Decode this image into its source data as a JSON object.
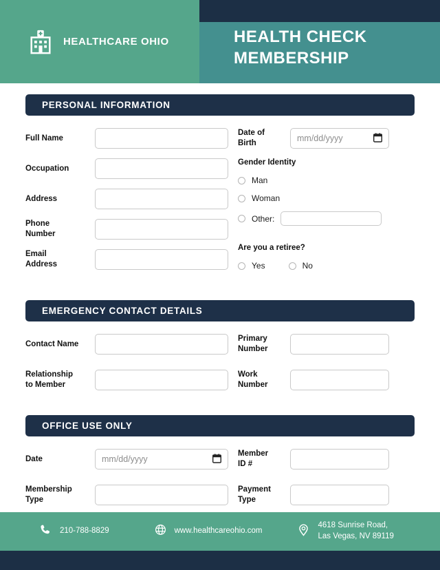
{
  "header": {
    "logo_icon": "hospital-icon",
    "brand": "HEALTHCARE OHIO",
    "title": "HEALTH CHECK\nMEMBERSHIP",
    "colors": {
      "green": "#55a68b",
      "teal": "#44908f",
      "navy": "#1c2f45",
      "section_navy": "#1e3048"
    }
  },
  "sections": {
    "personal": {
      "title": "PERSONAL INFORMATION",
      "left_fields": [
        {
          "label": "Full Name",
          "value": "",
          "placeholder": ""
        },
        {
          "label": "Occupation",
          "value": "",
          "placeholder": ""
        },
        {
          "label": "Address",
          "value": "",
          "placeholder": ""
        },
        {
          "label": "Phone\nNumber",
          "value": "",
          "placeholder": ""
        },
        {
          "label": "Email\nAddress",
          "value": "",
          "placeholder": ""
        }
      ],
      "dob": {
        "label": "Date of\nBirth",
        "placeholder": "mm/dd/yyyy",
        "value": "",
        "icon": "calendar-icon"
      },
      "gender": {
        "title": "Gender Identity",
        "options": [
          "Man",
          "Woman",
          "Other:"
        ],
        "other_value": "",
        "other_placeholder": ""
      },
      "retiree": {
        "title": "Are you a retiree?",
        "options": [
          "Yes",
          "No"
        ]
      }
    },
    "emergency": {
      "title": "EMERGENCY CONTACT DETAILS",
      "left_fields": [
        {
          "label": "Contact Name",
          "value": "",
          "placeholder": ""
        },
        {
          "label": "Relationship\nto Member",
          "value": "",
          "placeholder": ""
        }
      ],
      "right_fields": [
        {
          "label": "Primary\nNumber",
          "value": "",
          "placeholder": ""
        },
        {
          "label": "Work\nNumber",
          "value": "",
          "placeholder": ""
        }
      ]
    },
    "office": {
      "title": "OFFICE USE ONLY",
      "date": {
        "label": "Date",
        "placeholder": "mm/dd/yyyy",
        "value": "",
        "icon": "calendar-icon"
      },
      "membership_type": {
        "label": "Membership\nType",
        "value": "",
        "placeholder": ""
      },
      "right_fields": [
        {
          "label": "Member\nID #",
          "value": "",
          "placeholder": ""
        },
        {
          "label": "Payment\nType",
          "value": "",
          "placeholder": ""
        }
      ]
    }
  },
  "footer": {
    "phone_icon": "phone-icon",
    "phone": "210-788-8829",
    "web_icon": "globe-icon",
    "website": "www.healthcareohio.com",
    "location_icon": "map-pin-icon",
    "address": "4618 Sunrise Road,\nLas Vegas, NV 89119"
  }
}
